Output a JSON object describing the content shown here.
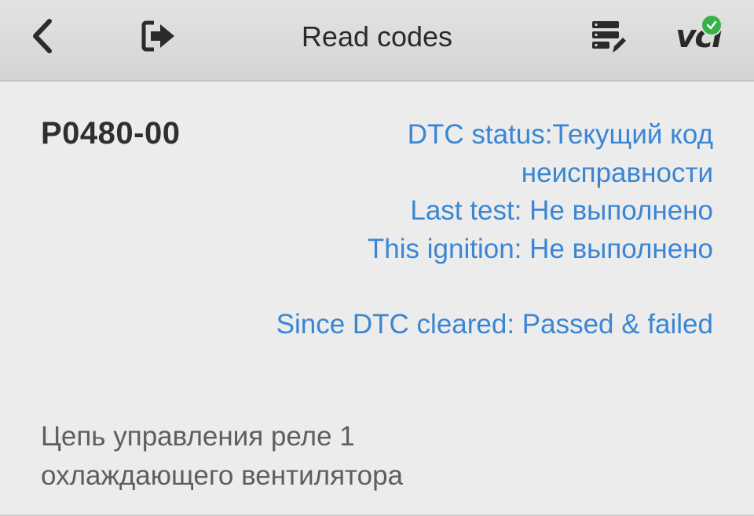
{
  "header": {
    "title": "Read codes",
    "back_icon": "chevron-left-icon",
    "exit_icon": "exit-icon",
    "report_icon": "report-edit-icon",
    "vci_label": "vci",
    "vci_status": "connected"
  },
  "dtc": {
    "code": "P0480-00",
    "status_line1": "DTC status:Текущий код неисправности",
    "last_test": "Last test: Не выполнено",
    "this_ignition": "This ignition: Не выполнено",
    "since_cleared": "Since DTC cleared: Passed & failed",
    "description": "Цепь управления реле 1 охлаждающего вентилятора"
  },
  "colors": {
    "accent": "#3a86d4",
    "vci_ok": "#35b24a"
  }
}
